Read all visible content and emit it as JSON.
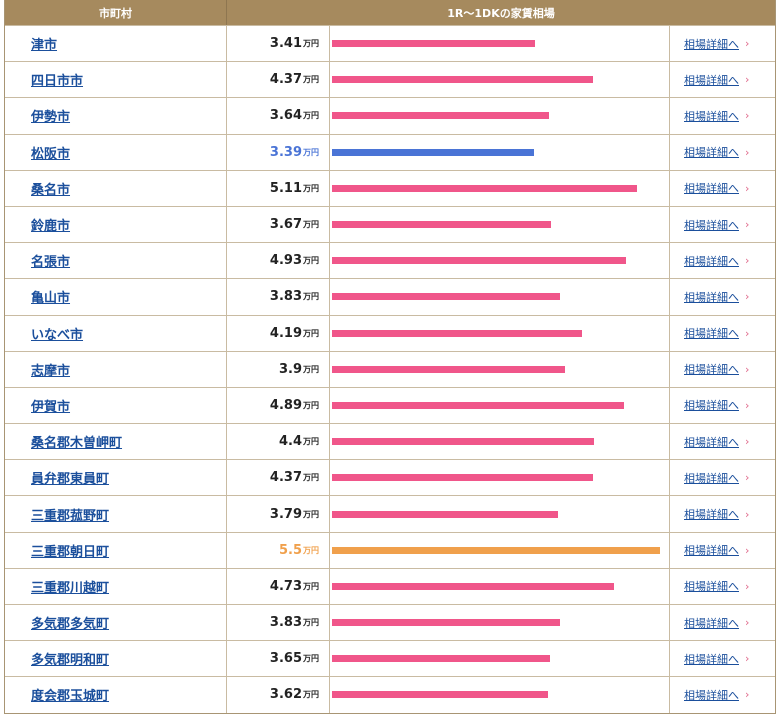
{
  "header": {
    "col_city": "市町村",
    "col_rent": "1R〜1DKの家賃相場"
  },
  "unit": "万円",
  "link_label": "相場詳細へ",
  "chevron": "›",
  "colors": {
    "default_bar": "#f0568a",
    "selected_bar": "#4a74d6",
    "max_bar": "#f0a04c",
    "link": "#1b4f9c"
  },
  "rows": [
    {
      "name": "津市",
      "value": "3.41",
      "highlight": ""
    },
    {
      "name": "四日市市",
      "value": "4.37",
      "highlight": ""
    },
    {
      "name": "伊勢市",
      "value": "3.64",
      "highlight": ""
    },
    {
      "name": "松阪市",
      "value": "3.39",
      "highlight": "selected"
    },
    {
      "name": "桑名市",
      "value": "5.11",
      "highlight": ""
    },
    {
      "name": "鈴鹿市",
      "value": "3.67",
      "highlight": ""
    },
    {
      "name": "名張市",
      "value": "4.93",
      "highlight": ""
    },
    {
      "name": "亀山市",
      "value": "3.83",
      "highlight": ""
    },
    {
      "name": "いなべ市",
      "value": "4.19",
      "highlight": ""
    },
    {
      "name": "志摩市",
      "value": "3.9",
      "highlight": ""
    },
    {
      "name": "伊賀市",
      "value": "4.89",
      "highlight": ""
    },
    {
      "name": "桑名郡木曽岬町",
      "value": "4.4",
      "highlight": ""
    },
    {
      "name": "員弁郡東員町",
      "value": "4.37",
      "highlight": ""
    },
    {
      "name": "三重郡菰野町",
      "value": "3.79",
      "highlight": ""
    },
    {
      "name": "三重郡朝日町",
      "value": "5.5",
      "highlight": "max"
    },
    {
      "name": "三重郡川越町",
      "value": "4.73",
      "highlight": ""
    },
    {
      "name": "多気郡多気町",
      "value": "3.83",
      "highlight": ""
    },
    {
      "name": "多気郡明和町",
      "value": "3.65",
      "highlight": ""
    },
    {
      "name": "度会郡玉城町",
      "value": "3.62",
      "highlight": ""
    }
  ]
}
